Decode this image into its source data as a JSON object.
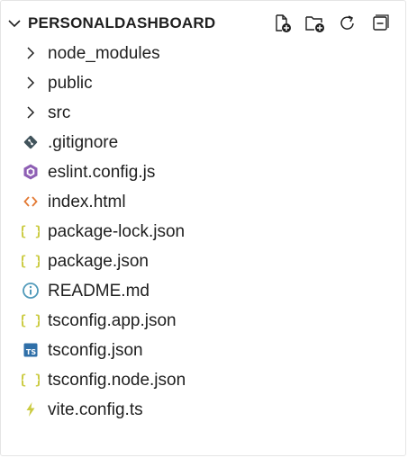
{
  "explorer": {
    "title": "PERSONALDASHBOARD",
    "actions": [
      {
        "name": "new-file-icon"
      },
      {
        "name": "new-folder-icon"
      },
      {
        "name": "refresh-icon"
      },
      {
        "name": "collapse-all-icon"
      }
    ],
    "items": [
      {
        "label": "node_modules",
        "icon": "chevron-right-icon",
        "type": "folder"
      },
      {
        "label": "public",
        "icon": "chevron-right-icon",
        "type": "folder"
      },
      {
        "label": "src",
        "icon": "chevron-right-icon",
        "type": "folder"
      },
      {
        "label": ".gitignore",
        "icon": "git-icon",
        "type": "file"
      },
      {
        "label": "eslint.config.js",
        "icon": "eslint-icon",
        "type": "file"
      },
      {
        "label": "index.html",
        "icon": "html-icon",
        "type": "file"
      },
      {
        "label": "package-lock.json",
        "icon": "json-icon",
        "type": "file"
      },
      {
        "label": "package.json",
        "icon": "json-icon",
        "type": "file"
      },
      {
        "label": "README.md",
        "icon": "info-icon",
        "type": "file"
      },
      {
        "label": "tsconfig.app.json",
        "icon": "json-icon",
        "type": "file"
      },
      {
        "label": "tsconfig.json",
        "icon": "typescript-icon",
        "type": "file"
      },
      {
        "label": "tsconfig.node.json",
        "icon": "json-icon",
        "type": "file"
      },
      {
        "label": "vite.config.ts",
        "icon": "vite-icon",
        "type": "file"
      }
    ]
  },
  "colors": {
    "json": "#cbcb41",
    "html": "#e37933",
    "eslint": "#8e5fb4",
    "info": "#519aba",
    "ts": "#2f6fa8",
    "git": "#41535b",
    "vite": "#cbcb41",
    "text": "#1f1f1f"
  }
}
